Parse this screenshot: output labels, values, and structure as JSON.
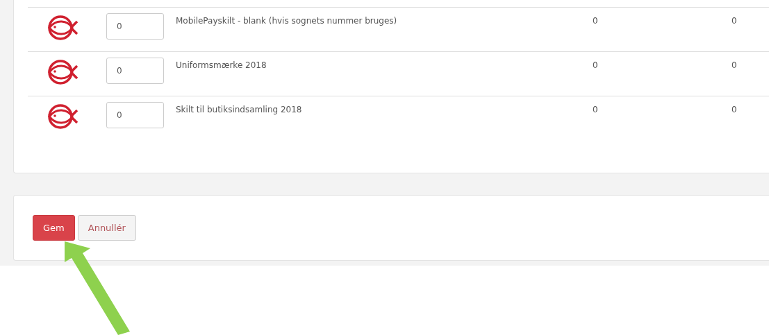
{
  "rows": [
    {
      "quantity": "0",
      "name": "MobilePayskilt - blank (hvis sognets nummer bruges)",
      "column_3": "0",
      "column_4": "0"
    },
    {
      "quantity": "0",
      "name": "Uniformsmærke 2018",
      "column_3": "0",
      "column_4": "0"
    },
    {
      "quantity": "0",
      "name": "Skilt til butiksindsamling 2018",
      "column_3": "0",
      "column_4": "0"
    }
  ],
  "buttons": [
    {
      "label": "Gem",
      "kind": "primary"
    },
    {
      "label": "Annullér",
      "kind": "secondary"
    }
  ]
}
